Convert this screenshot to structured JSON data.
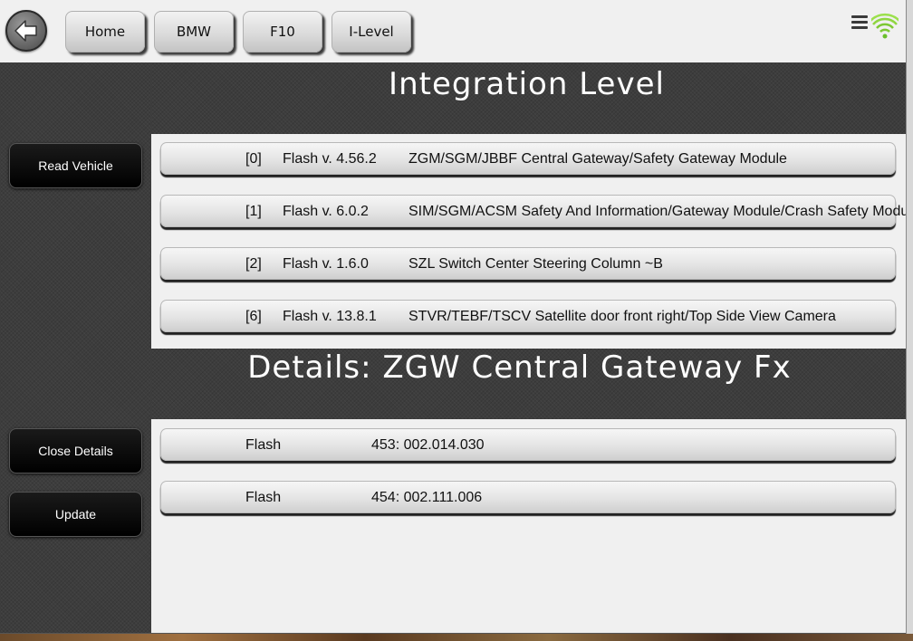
{
  "nav": {
    "buttons": [
      "Home",
      "BMW",
      "F10",
      "I-Level"
    ]
  },
  "sections": {
    "integration_title": "Integration Level",
    "details_title": "Details: ZGW Central Gateway Fx"
  },
  "sidebar": {
    "read_vehicle": "Read Vehicle",
    "close_details": "Close Details",
    "update": "Update"
  },
  "modules": [
    {
      "index": "[0]",
      "flash": "Flash v. 4.56.2",
      "description": "ZGM/SGM/JBBF Central Gateway/Safety Gateway Module"
    },
    {
      "index": "[1]",
      "flash": "Flash v. 6.0.2",
      "description": "SIM/SGM/ACSM Safety And Information/Gateway Module/Crash Safety Module"
    },
    {
      "index": "[2]",
      "flash": "Flash v. 1.6.0",
      "description": "SZL Switch Center Steering Column ~B"
    },
    {
      "index": "[6]",
      "flash": "Flash v. 13.8.1",
      "description": "STVR/TEBF/TSCV Satellite door front right/Top Side View Camera"
    }
  ],
  "details": [
    {
      "label": "Flash",
      "value": "453: 002.014.030"
    },
    {
      "label": "Flash",
      "value": "454: 002.111.006"
    }
  ],
  "icons": {
    "back": "back-arrow-icon",
    "menu": "menu-icon",
    "signal": "wifi-signal-icon"
  },
  "colors": {
    "signal_green": "#7cc832",
    "dark_panel": "#3d3d3d",
    "button_black": "#000000"
  }
}
